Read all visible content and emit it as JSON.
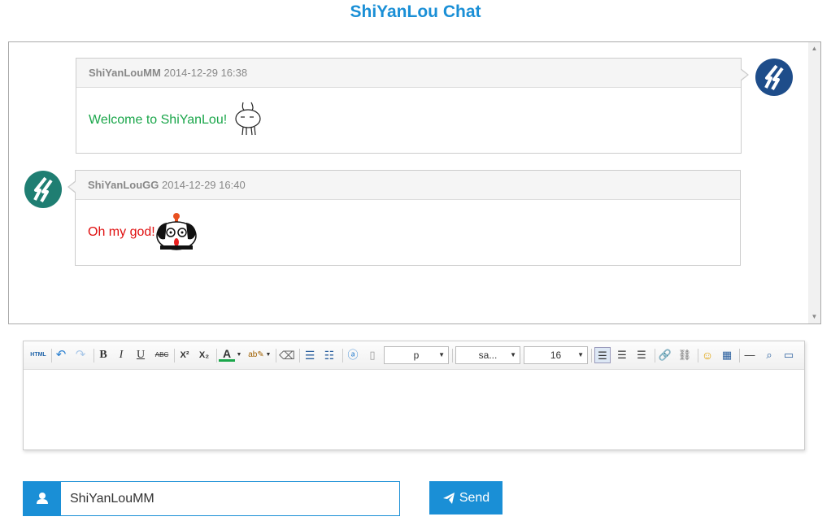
{
  "app": {
    "title": "ShiYanLou Chat"
  },
  "colors": {
    "accent": "#1a8fd6",
    "welcome_text": "#1aa64a",
    "reply_text": "#e01010"
  },
  "messages": [
    {
      "user": "ShiYanLouMM",
      "time": "2014-12-29 16:38",
      "text": "Welcome to ShiYanLou!",
      "emoji": "rabbit-emoji",
      "side": "right"
    },
    {
      "user": "ShiYanLouGG",
      "time": "2014-12-29 16:40",
      "text": "Oh my god!",
      "emoji": "panda-emoji",
      "side": "left"
    }
  ],
  "toolbar": {
    "html": "HTML",
    "bold": "B",
    "italic": "I",
    "underline": "U",
    "strike": "ABC",
    "superscript": "X²",
    "subscript": "X₂",
    "font_color": "A",
    "paragraph": "p",
    "font_family": "sa...",
    "font_size": "16"
  },
  "form": {
    "username": "ShiYanLouMM",
    "send_label": "Send"
  }
}
